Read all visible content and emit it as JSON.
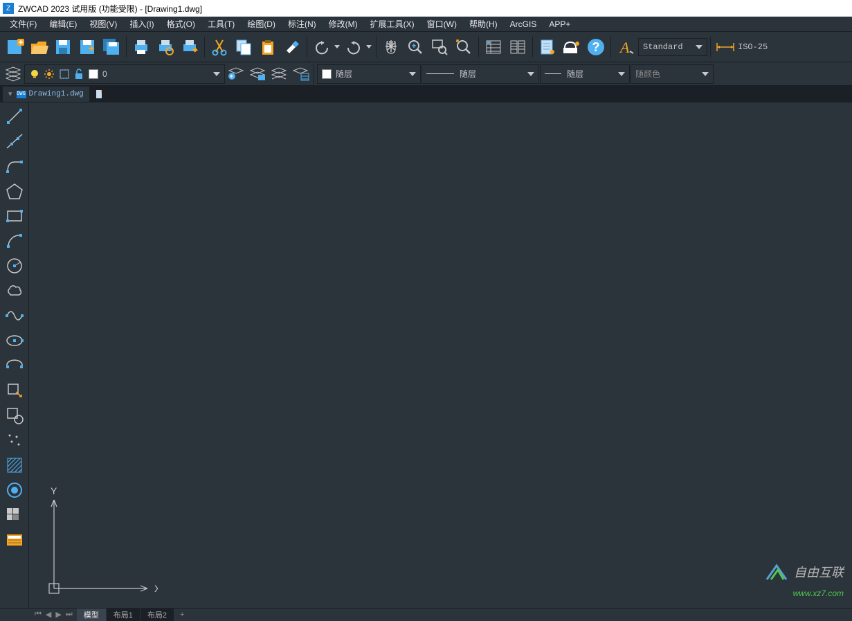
{
  "title": "ZWCAD 2023 试用版 (功能受限) - [Drawing1.dwg]",
  "menus": {
    "file": "文件(F)",
    "edit": "编辑(E)",
    "view": "视图(V)",
    "insert": "插入(I)",
    "format": "格式(O)",
    "tools": "工具(T)",
    "draw": "绘图(D)",
    "dimension": "标注(N)",
    "modify": "修改(M)",
    "ext": "扩展工具(X)",
    "window": "窗口(W)",
    "help": "帮助(H)",
    "arcgis": "ArcGIS",
    "app": "APP+"
  },
  "text_style": "Standard",
  "dim_style": "ISO-25",
  "layer": {
    "name": "0"
  },
  "color_label": "随颜色",
  "byLayer": "随层",
  "tab_name": "Drawing1.dwg",
  "tab_icon_text": "DWG",
  "footer": {
    "model": "模型",
    "layout1": "布局1",
    "layout2": "布局2"
  },
  "ucs": {
    "x": "X",
    "y": "Y"
  },
  "watermark": {
    "line1": "自由互联",
    "line2": "www.xz7.com"
  }
}
